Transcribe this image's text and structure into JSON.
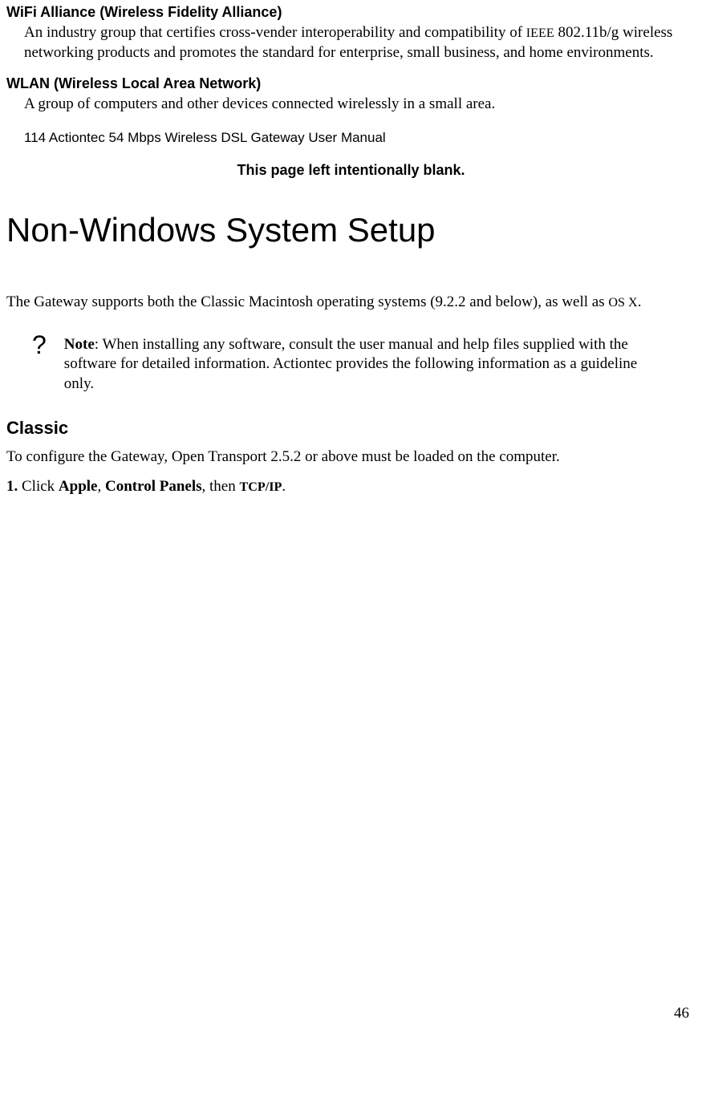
{
  "glossary": {
    "wifi": {
      "term": "WiFi Alliance (Wireless Fidelity Alliance)",
      "def_pre": "An industry group that certifies cross-vender interoperability and compatibility of ",
      "def_sc": "IEEE",
      "def_post": " 802.11b/g wireless networking products and promotes the standard for enterprise, small business, and home environments."
    },
    "wlan": {
      "term": "WLAN (Wireless Local Area Network)",
      "def": "A group of computers and other devices connected wirelessly in a small area."
    }
  },
  "header_line": "114 Actiontec 54 Mbps Wireless DSL Gateway User Manual",
  "blank_notice": "This page left intentionally blank.",
  "section_title": "Non-Windows System Setup",
  "intro": {
    "pre": "The Gateway supports both the Classic Macintosh operating systems (9.2.2 and below), as well as ",
    "sc": "OS X",
    "post": "."
  },
  "note": {
    "icon": "?",
    "label": "Note",
    "text": ": When installing any software, consult the user manual and help files supplied with the software for detailed information. Actiontec provides the following information as a guideline only."
  },
  "subsection": "Classic",
  "classic_intro": "To configure the Gateway, Open Transport 2.5.2 or above must be loaded on the computer.",
  "step1": {
    "num": "1.",
    "t1": " Click ",
    "b1": "Apple",
    "t2": ", ",
    "b2": "Control Panels",
    "t3": ", then ",
    "b3": "TCP/IP",
    "t4": "."
  },
  "page_number": "46"
}
